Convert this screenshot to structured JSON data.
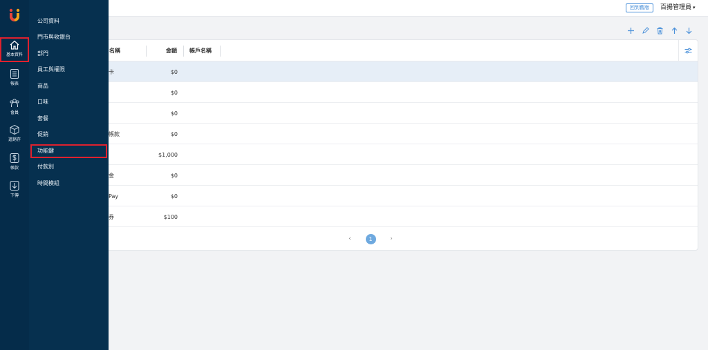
{
  "header": {
    "back_old_label": "回到舊版",
    "admin_name": "百揚管理員",
    "admin_caret": "▾"
  },
  "toolbar": {
    "icons": [
      "plus-icon",
      "pencil-icon",
      "trash-icon",
      "arrow-up-icon",
      "arrow-down-icon"
    ]
  },
  "table": {
    "columns": {
      "name": "名稱",
      "amount": "金額",
      "account": "帳戶名稱"
    },
    "rows": [
      {
        "name": "卡",
        "amount": "$0"
      },
      {
        "name": "",
        "amount": "$0"
      },
      {
        "name": "",
        "amount": "$0"
      },
      {
        "name": "帳款",
        "amount": "$0"
      },
      {
        "name": "",
        "amount": "$1,000"
      },
      {
        "name": "金",
        "amount": "$0"
      },
      {
        "name": "Pay",
        "amount": "$0"
      },
      {
        "name": "券",
        "amount": "$100"
      }
    ],
    "selected_row_index": 0
  },
  "pagination": {
    "prev": "‹",
    "current_page": "1",
    "next": "›"
  },
  "sidebar": {
    "items": [
      {
        "label": "基本資料",
        "icon": "home-icon",
        "active": true
      },
      {
        "label": "報表",
        "icon": "report-icon",
        "active": false
      },
      {
        "label": "會員",
        "icon": "members-icon",
        "active": false
      },
      {
        "label": "進銷存",
        "icon": "inventory-box-icon",
        "active": false
      },
      {
        "label": "帳款",
        "icon": "dollar-icon",
        "active": false
      },
      {
        "label": "下傳",
        "icon": "download-icon",
        "active": false
      }
    ]
  },
  "submenu": {
    "items": [
      "公司資料",
      "門市與收銀台",
      "部門",
      "員工與權限",
      "商品",
      "口味",
      "套餐",
      "促銷",
      "功能鍵",
      "付款別",
      "時間模組"
    ],
    "highlighted": "功能鍵"
  },
  "colors": {
    "sidebar_bg": "#052c4a",
    "submenu_bg": "#06304f",
    "accent": "#4a90d9",
    "highlight_border": "#e0212e"
  }
}
